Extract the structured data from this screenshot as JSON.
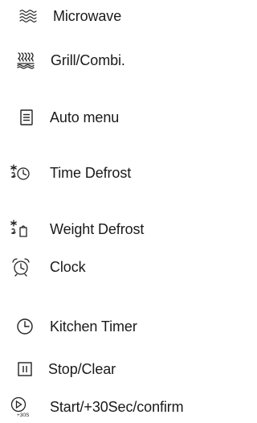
{
  "items": [
    {
      "label": "Microwave",
      "icon": "microwave-waves-icon"
    },
    {
      "label": "Grill/Combi.",
      "icon": "grill-combi-icon"
    },
    {
      "label": "Auto menu",
      "icon": "auto-menu-icon"
    },
    {
      "label": "Time Defrost",
      "icon": "time-defrost-icon"
    },
    {
      "label": "Weight Defrost",
      "icon": "weight-defrost-icon"
    },
    {
      "label": "Clock",
      "icon": "alarm-clock-icon"
    },
    {
      "label": "Kitchen Timer",
      "icon": "kitchen-timer-icon"
    },
    {
      "label": "Stop/Clear",
      "icon": "stop-clear-icon"
    },
    {
      "label": "Start/+30Sec/confirm",
      "icon": "start-30sec-icon",
      "icon_text": "+30S"
    }
  ],
  "colors": {
    "text": "#1a1a1a",
    "icon": "#222222",
    "background": "#ffffff"
  }
}
